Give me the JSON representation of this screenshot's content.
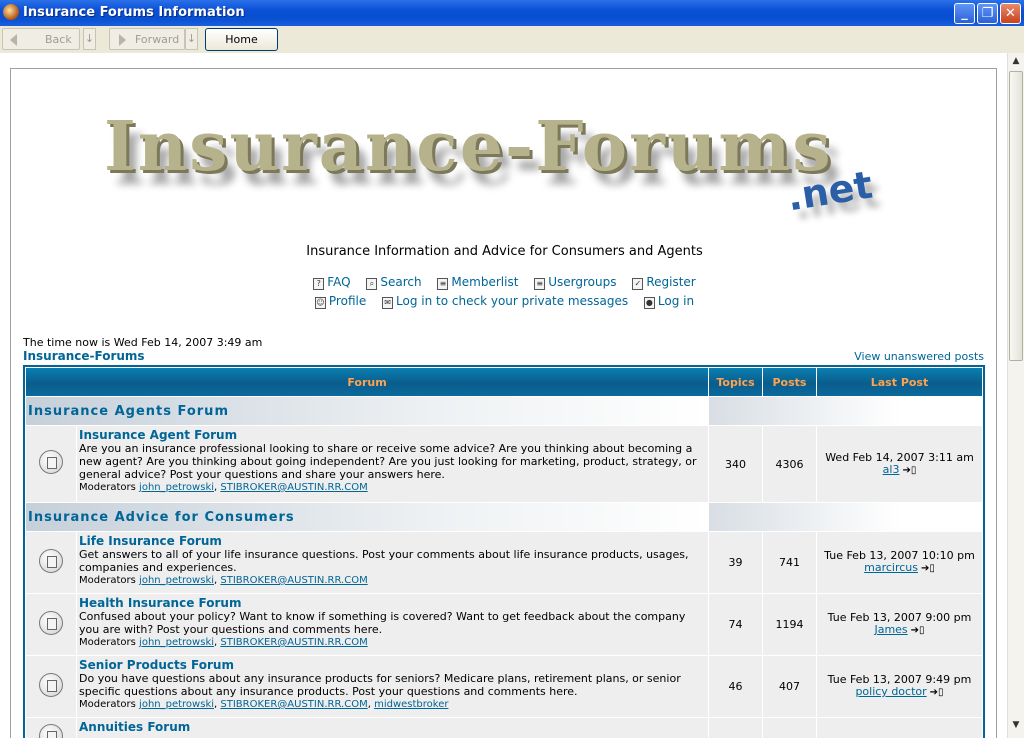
{
  "window": {
    "title": "Insurance Forums Information",
    "buttons": {
      "minimize": "_",
      "maximize": "❐",
      "close": "✕"
    }
  },
  "toolbar": {
    "back": "Back",
    "forward": "Forward",
    "home": "Home"
  },
  "logo": {
    "main": "Insurance-Forums",
    "suffix": ".net"
  },
  "tagline": "Insurance Information and Advice for Consumers and Agents",
  "nav": {
    "faq": "FAQ",
    "search": "Search",
    "memberlist": "Memberlist",
    "usergroups": "Usergroups",
    "register": "Register",
    "profile": "Profile",
    "messages": "Log in to check your private messages",
    "login": "Log in"
  },
  "time_now": "The time now is Wed Feb 14, 2007 3:49 am",
  "breadcrumb": "Insurance-Forums",
  "view_unanswered": "View unanswered posts",
  "table": {
    "headers": {
      "forum": "Forum",
      "topics": "Topics",
      "posts": "Posts",
      "last_post": "Last Post"
    },
    "categories": [
      "Insurance Agents Forum",
      "Insurance Advice for Consumers"
    ],
    "moderators_label": "Moderators",
    "forums": [
      {
        "name": "Insurance Agent Forum",
        "desc": "Are you an insurance professional looking to share or receive some advice? Are you thinking about becoming a new agent? Are you thinking about going independent? Are you just looking for marketing, product, strategy, or general advice? Post your questions and share your answers here.",
        "mods": [
          "john_petrowski",
          "STIBROKER@AUSTIN.RR.COM"
        ],
        "topics": "340",
        "posts": "4306",
        "last_date": "Wed Feb 14, 2007 3:11 am",
        "last_user": "al3"
      },
      {
        "name": "Life Insurance Forum",
        "desc": "Get answers to all of your life insurance questions. Post your comments about life insurance products, usages, companies and experiences.",
        "mods": [
          "john_petrowski",
          "STIBROKER@AUSTIN.RR.COM"
        ],
        "topics": "39",
        "posts": "741",
        "last_date": "Tue Feb 13, 2007 10:10 pm",
        "last_user": "marcircus"
      },
      {
        "name": "Health Insurance Forum",
        "desc": "Confused about your policy? Want to know if something is covered? Want to get feedback about the company you are with? Post your questions and comments here.",
        "mods": [
          "john_petrowski",
          "STIBROKER@AUSTIN.RR.COM"
        ],
        "topics": "74",
        "posts": "1194",
        "last_date": "Tue Feb 13, 2007 9:00 pm",
        "last_user": "James"
      },
      {
        "name": "Senior Products Forum",
        "desc": "Do you have questions about any insurance products for seniors? Medicare plans, retirement plans, or senior specific questions about any insurance products. Post your questions and comments here.",
        "mods": [
          "john_petrowski",
          "STIBROKER@AUSTIN.RR.COM",
          "midwestbroker"
        ],
        "topics": "46",
        "posts": "407",
        "last_date": "Tue Feb 13, 2007 9:49 pm",
        "last_user": "policy doctor"
      },
      {
        "name": "Annuities Forum"
      }
    ]
  }
}
